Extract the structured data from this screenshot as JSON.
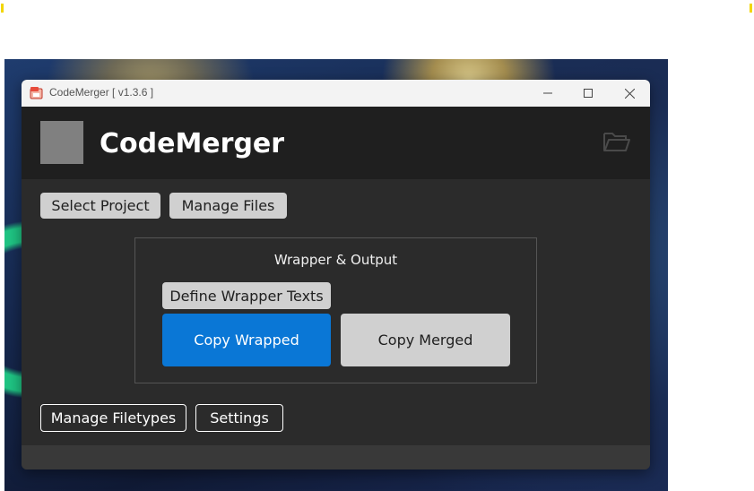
{
  "window": {
    "title": "CodeMerger [ v1.3.6 ]",
    "controls": {
      "minimize": "—",
      "maximize": "☐",
      "close": "✕"
    }
  },
  "header": {
    "app_name": "CodeMerger"
  },
  "toolbar": {
    "select_project": "Select Project",
    "manage_files": "Manage Files"
  },
  "wrapper_group": {
    "title": "Wrapper & Output",
    "define_wrapper": "Define Wrapper Texts",
    "copy_wrapped": "Copy Wrapped",
    "copy_merged": "Copy Merged"
  },
  "bottom": {
    "manage_filetypes": "Manage Filetypes",
    "settings": "Settings"
  },
  "colors": {
    "accent": "#0a77d6",
    "header_bg": "#1f1f1f",
    "body_bg": "#2b2b2b",
    "light_button": "#d0d0d0"
  },
  "icons": {
    "app": "app-icon",
    "folder": "open-folder-icon"
  }
}
